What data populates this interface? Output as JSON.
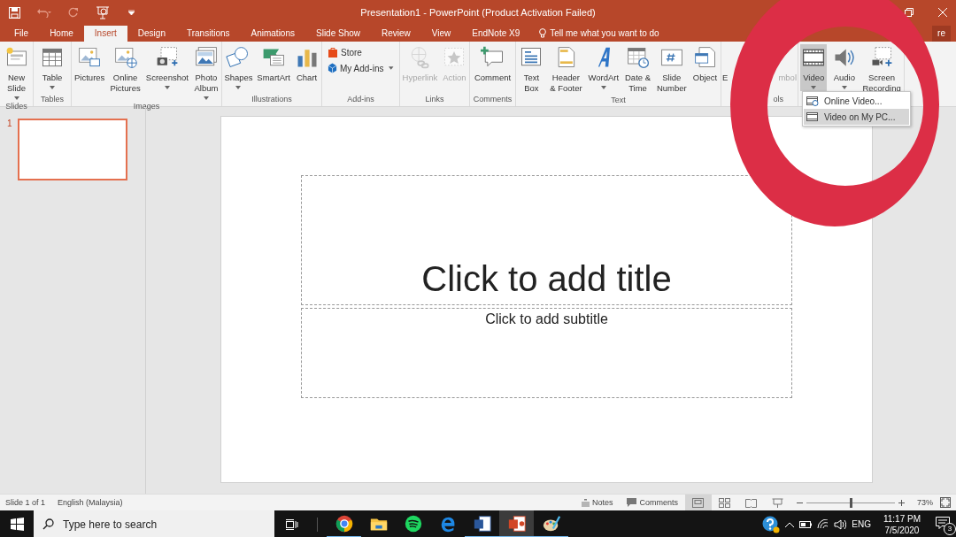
{
  "title_bar": {
    "title": "Presentation1 - PowerPoint (Product Activation Failed)"
  },
  "tabs": [
    {
      "label": "File",
      "selected": false
    },
    {
      "label": "Home",
      "selected": false
    },
    {
      "label": "Insert",
      "selected": true
    },
    {
      "label": "Design",
      "selected": false
    },
    {
      "label": "Transitions",
      "selected": false
    },
    {
      "label": "Animations",
      "selected": false
    },
    {
      "label": "Slide Show",
      "selected": false
    },
    {
      "label": "Review",
      "selected": false
    },
    {
      "label": "View",
      "selected": false
    },
    {
      "label": "EndNote X9",
      "selected": false
    }
  ],
  "tell_me": {
    "placeholder": "Tell me what you want to do"
  },
  "share": {
    "label": "re"
  },
  "ribbon_groups": [
    {
      "label": "Slides",
      "buttons": [
        {
          "label": "New\nSlide",
          "dropdown": true,
          "disabled": false,
          "pressed": false
        }
      ]
    },
    {
      "label": "Tables",
      "buttons": [
        {
          "label": "Table",
          "dropdown": true,
          "disabled": false,
          "pressed": false
        }
      ]
    },
    {
      "label": "Images",
      "buttons": [
        {
          "label": "Pictures",
          "dropdown": false,
          "disabled": false,
          "pressed": false
        },
        {
          "label": "Online\nPictures",
          "dropdown": false,
          "disabled": false,
          "pressed": false
        },
        {
          "label": "Screenshot",
          "dropdown": true,
          "disabled": false,
          "pressed": false
        },
        {
          "label": "Photo\nAlbum",
          "dropdown": true,
          "disabled": false,
          "pressed": false
        }
      ]
    },
    {
      "label": "Illustrations",
      "buttons": [
        {
          "label": "Shapes",
          "dropdown": true,
          "disabled": false,
          "pressed": false
        },
        {
          "label": "SmartArt",
          "dropdown": false,
          "disabled": false,
          "pressed": false
        },
        {
          "label": "Chart",
          "dropdown": false,
          "disabled": false,
          "pressed": false
        }
      ]
    },
    {
      "label": "Add-ins",
      "small_buttons": [
        {
          "label": "Store",
          "dropdown": false
        },
        {
          "label": "My Add-ins",
          "dropdown": true
        }
      ]
    },
    {
      "label": "Links",
      "buttons": [
        {
          "label": "Hyperlink",
          "dropdown": false,
          "disabled": true,
          "pressed": false
        },
        {
          "label": "Action",
          "dropdown": false,
          "disabled": true,
          "pressed": false
        }
      ]
    },
    {
      "label": "Comments",
      "buttons": [
        {
          "label": "Comment",
          "dropdown": false,
          "disabled": false,
          "pressed": false
        }
      ]
    },
    {
      "label": "Text",
      "buttons": [
        {
          "label": "Text\nBox",
          "dropdown": false,
          "disabled": false,
          "pressed": false
        },
        {
          "label": "Header\n& Footer",
          "dropdown": false,
          "disabled": false,
          "pressed": false
        },
        {
          "label": "WordArt",
          "dropdown": true,
          "disabled": false,
          "pressed": false
        },
        {
          "label": "Date &\nTime",
          "dropdown": false,
          "disabled": false,
          "pressed": false
        },
        {
          "label": "Slide\nNumber",
          "dropdown": false,
          "disabled": false,
          "pressed": false
        },
        {
          "label": "Object",
          "dropdown": false,
          "disabled": false,
          "pressed": false
        }
      ]
    },
    {
      "label": "ols",
      "buttons": [
        {
          "label": "E",
          "dropdown": false,
          "disabled": false,
          "pressed": false
        },
        {
          "label": "mbol",
          "dropdown": false,
          "disabled": true,
          "pressed": false
        }
      ]
    },
    {
      "buttons": [
        {
          "label": "Video",
          "dropdown": true,
          "disabled": false,
          "pressed": true
        },
        {
          "label": "Audio",
          "dropdown": true,
          "disabled": false,
          "pressed": false
        },
        {
          "label": "Screen\nRecording",
          "dropdown": false,
          "disabled": false,
          "pressed": false
        }
      ]
    }
  ],
  "video_menu": [
    {
      "label": "Online Video...",
      "selected": false
    },
    {
      "label": "Video on My PC...",
      "selected": true
    }
  ],
  "thumbnails": [
    {
      "number": "1",
      "selected": true
    }
  ],
  "slide": {
    "title_placeholder": "Click to add title",
    "subtitle_placeholder": "Click to add subtitle"
  },
  "status_bar": {
    "slide_info": "Slide 1 of 1",
    "language": "English (Malaysia)",
    "notes": "Notes",
    "comments": "Comments",
    "views": [
      {
        "selected": true
      },
      {
        "selected": false
      },
      {
        "selected": false
      },
      {
        "selected": false
      }
    ],
    "zoom": {
      "level": 0.5,
      "reading": "73%"
    }
  },
  "taskbar": {
    "search": {
      "placeholder": "Type here to search"
    },
    "apps": [
      {
        "running": true,
        "active": false
      },
      {
        "running": false,
        "active": false
      },
      {
        "running": false,
        "active": false
      },
      {
        "running": false,
        "active": false
      },
      {
        "running": true,
        "active": false
      },
      {
        "running": true,
        "active": true
      },
      {
        "running": true,
        "active": false
      }
    ],
    "language": "ENG",
    "time": "11:17 PM",
    "date": "7/5/2020",
    "notifications": "3"
  }
}
